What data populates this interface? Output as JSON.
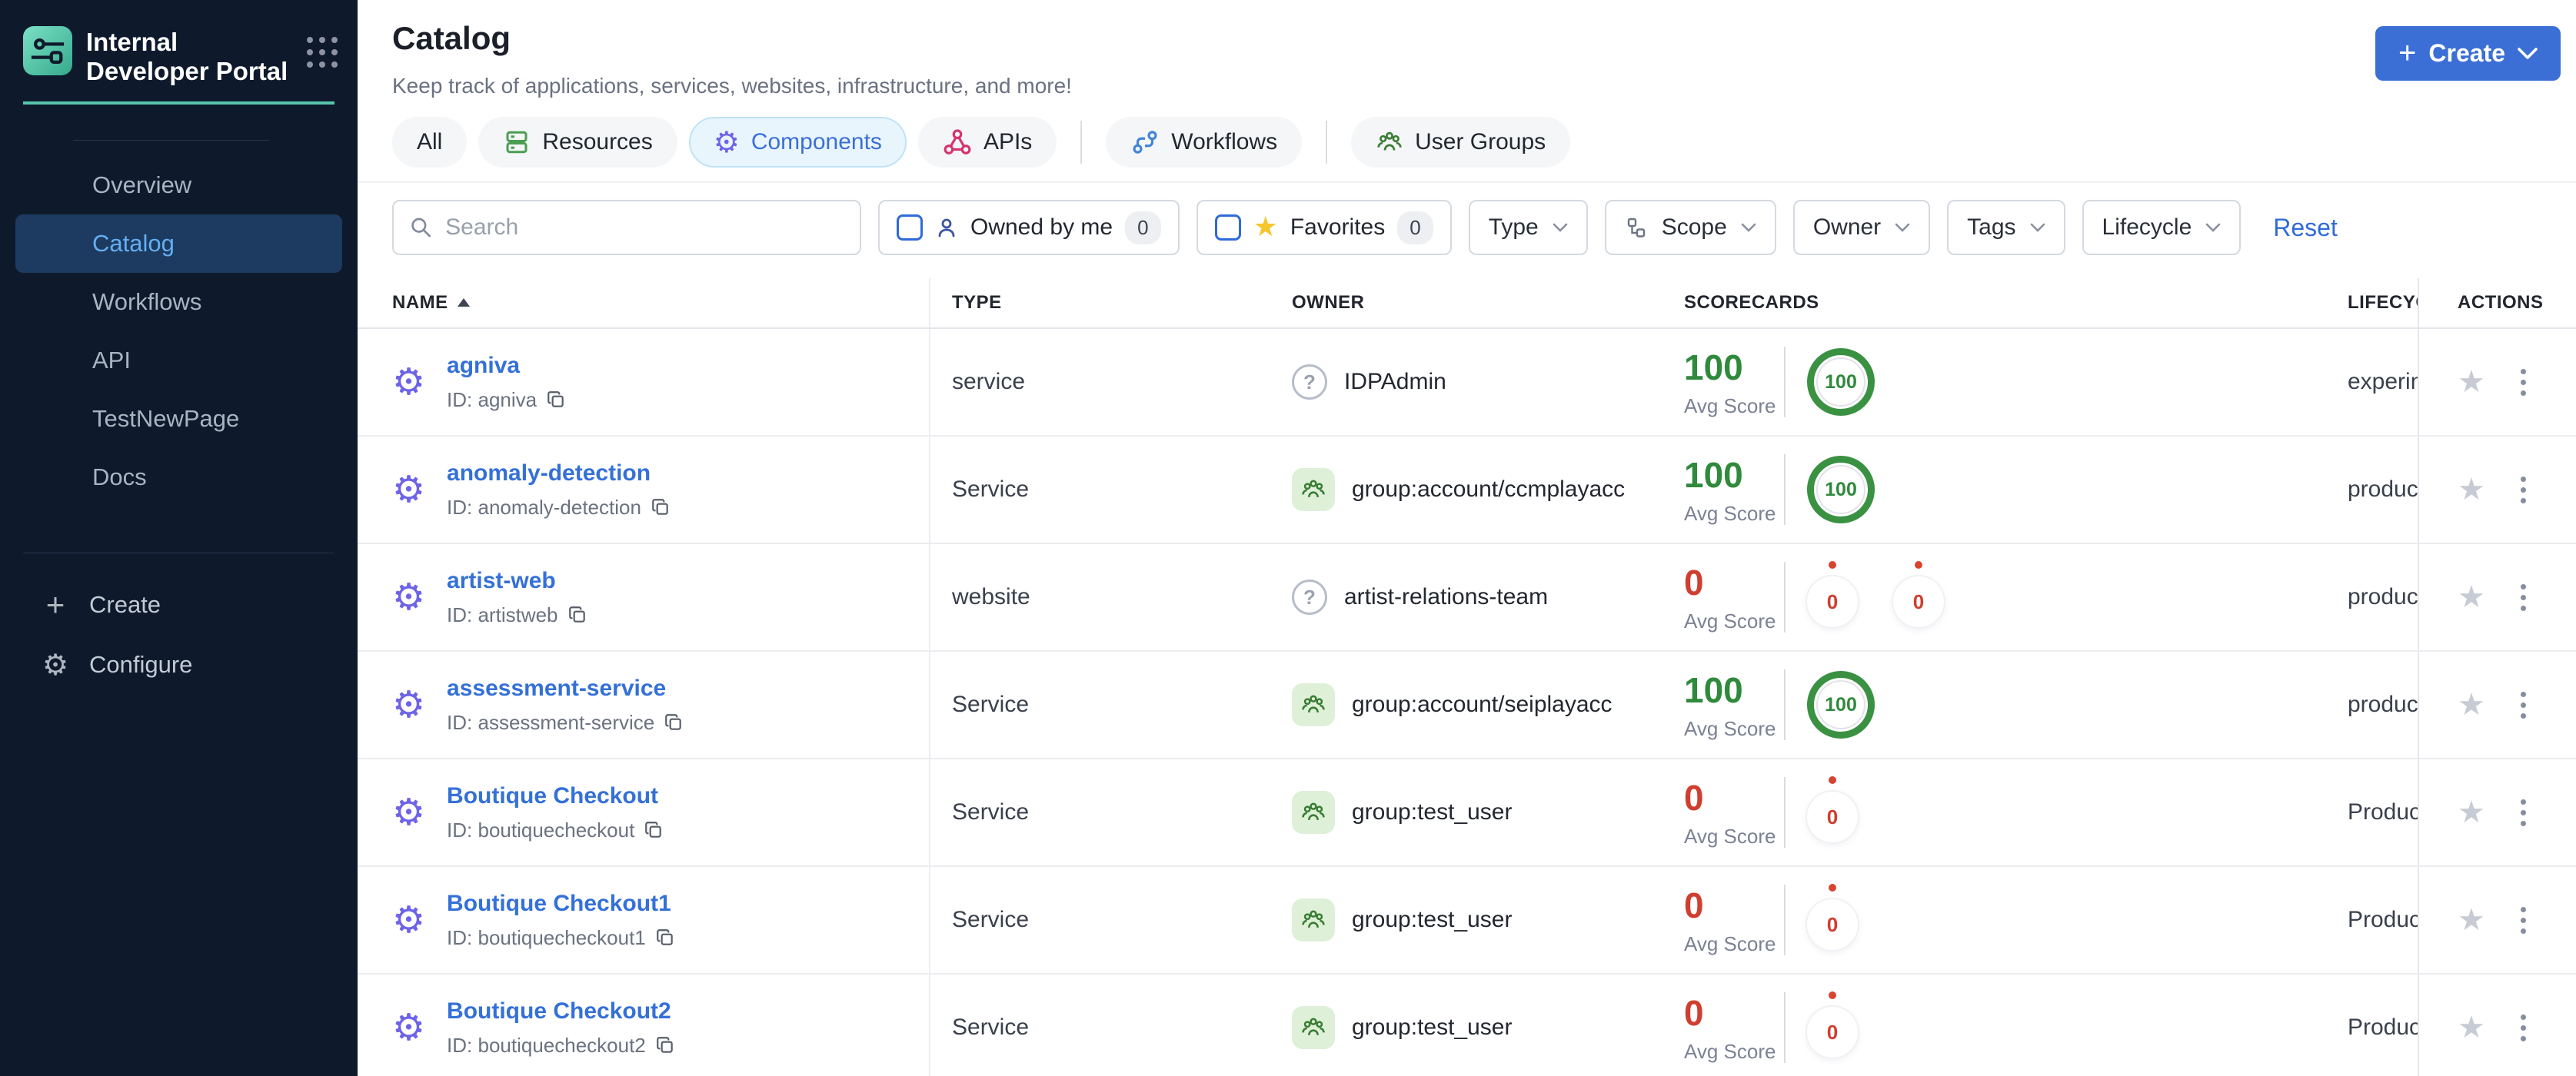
{
  "sidebar": {
    "logo_title": "Internal Developer Portal",
    "nav": [
      {
        "label": "Overview",
        "active": false
      },
      {
        "label": "Catalog",
        "active": true
      },
      {
        "label": "Workflows",
        "active": false
      },
      {
        "label": "API",
        "active": false
      },
      {
        "label": "TestNewPage",
        "active": false
      },
      {
        "label": "Docs",
        "active": false
      }
    ],
    "create_label": "Create",
    "configure_label": "Configure"
  },
  "header": {
    "title": "Catalog",
    "subtitle": "Keep track of applications, services, websites, infrastructure, and more!",
    "create_button": "Create"
  },
  "tabs": [
    {
      "label": "All",
      "active": false
    },
    {
      "label": "Resources",
      "active": false,
      "icon": "resources-icon"
    },
    {
      "label": "Components",
      "active": true,
      "icon": "components-gear-icon"
    },
    {
      "label": "APIs",
      "active": false,
      "icon": "apis-icon"
    },
    {
      "label": "Workflows",
      "active": false,
      "icon": "workflows-icon"
    },
    {
      "label": "User Groups",
      "active": false,
      "icon": "user-groups-icon"
    }
  ],
  "filters": {
    "search_placeholder": "Search",
    "owned_by_me": {
      "label": "Owned by me",
      "count": "0",
      "checked": false
    },
    "favorites": {
      "label": "Favorites",
      "count": "0",
      "checked": false
    },
    "dropdowns": [
      "Type",
      "Scope",
      "Owner",
      "Tags",
      "Lifecycle"
    ],
    "reset_label": "Reset"
  },
  "table": {
    "headers": {
      "name": "NAME",
      "type": "TYPE",
      "owner": "OWNER",
      "scorecards": "SCORECARDS",
      "lifecycle": "LIFECYCLE",
      "actions": "ACTIONS"
    },
    "avg_score_label": "Avg Score",
    "rows": [
      {
        "name": "agniva",
        "id": "ID: agniva",
        "type": "service",
        "owner": "IDPAdmin",
        "owner_icon": "unknown",
        "score": "100",
        "score_color": "green",
        "rings": [
          {
            "value": "100",
            "variant": "high"
          }
        ],
        "lifecycle": "experimental"
      },
      {
        "name": "anomaly-detection",
        "id": "ID: anomaly-detection",
        "type": "Service",
        "owner": "group:account/ccmplayacc",
        "owner_icon": "group",
        "score": "100",
        "score_color": "green",
        "rings": [
          {
            "value": "100",
            "variant": "high"
          }
        ],
        "lifecycle": "production"
      },
      {
        "name": "artist-web",
        "id": "ID: artistweb",
        "type": "website",
        "owner": "artist-relations-team",
        "owner_icon": "unknown",
        "score": "0",
        "score_color": "red",
        "rings": [
          {
            "value": "0",
            "variant": "zero"
          },
          {
            "value": "0",
            "variant": "zero"
          }
        ],
        "lifecycle": "production"
      },
      {
        "name": "assessment-service",
        "id": "ID: assessment-service",
        "type": "Service",
        "owner": "group:account/seiplayacc",
        "owner_icon": "group",
        "score": "100",
        "score_color": "green",
        "rings": [
          {
            "value": "100",
            "variant": "high"
          }
        ],
        "lifecycle": "production"
      },
      {
        "name": "Boutique Checkout",
        "id": "ID: boutiquecheckout",
        "type": "Service",
        "owner": "group:test_user",
        "owner_icon": "group",
        "score": "0",
        "score_color": "red",
        "rings": [
          {
            "value": "0",
            "variant": "zero"
          }
        ],
        "lifecycle": "Production"
      },
      {
        "name": "Boutique Checkout1",
        "id": "ID: boutiquecheckout1",
        "type": "Service",
        "owner": "group:test_user",
        "owner_icon": "group",
        "score": "0",
        "score_color": "red",
        "rings": [
          {
            "value": "0",
            "variant": "zero"
          }
        ],
        "lifecycle": "Production"
      },
      {
        "name": "Boutique Checkout2",
        "id": "ID: boutiquecheckout2",
        "type": "Service",
        "owner": "group:test_user",
        "owner_icon": "group",
        "score": "0",
        "score_color": "red",
        "rings": [
          {
            "value": "0",
            "variant": "zero"
          }
        ],
        "lifecycle": "Production"
      }
    ]
  },
  "colors": {
    "primary_blue": "#3B6FD6",
    "link_blue": "#3470D8",
    "teal_accent": "#57C5AC",
    "sidebar_bg": "#0E1A2C",
    "active_nav_bg": "#1D3B60",
    "active_nav_text": "#64AEF2",
    "active_tab_bg": "#E9F5FC",
    "score_green": "#2F8A3C",
    "score_red": "#CF3E2F",
    "group_badge_bg": "#DEF0D8",
    "group_icon_green": "#3A7D34",
    "favorite_yellow": "#F6C62D"
  },
  "icons": {
    "apps-grid-icon": "3x3 dot grid",
    "search-icon": "magnifier",
    "components-gear-icon": "gear",
    "copy-icon": "overlapping squares",
    "more-actions-icon": "vertical kebab dots",
    "favorite-star-icon": "star",
    "unknown-owner-icon": "question mark circle",
    "group-owner-icon": "people in green square"
  }
}
